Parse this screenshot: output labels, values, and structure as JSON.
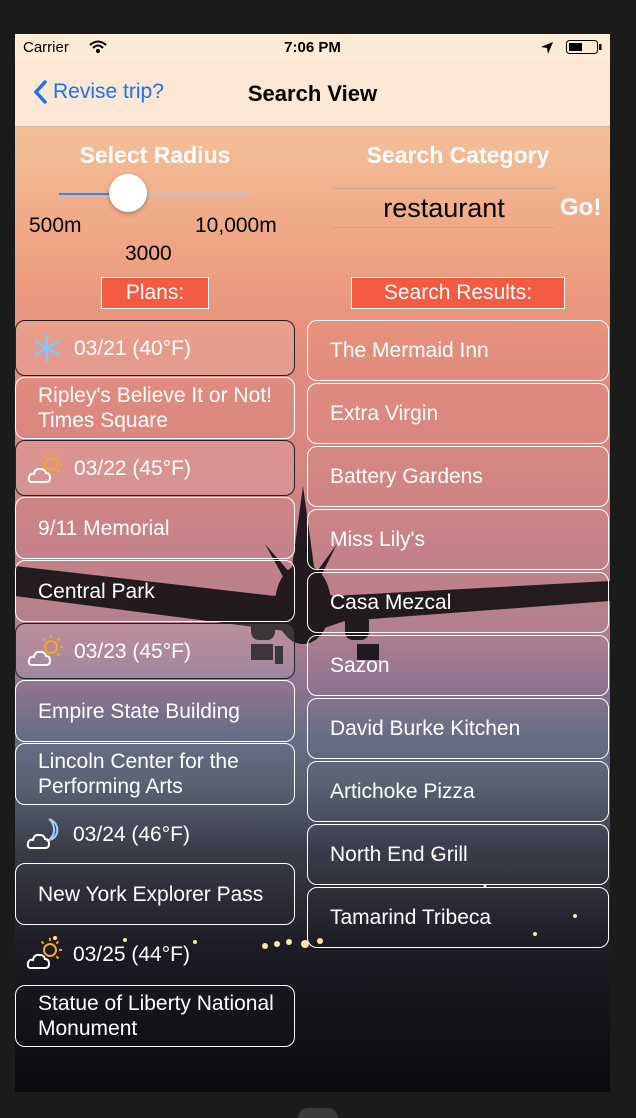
{
  "status": {
    "carrier": "Carrier",
    "time": "7:06 PM"
  },
  "nav": {
    "back_label": "Revise trip?",
    "title": "Search View"
  },
  "radius": {
    "heading": "Select Radius",
    "min_label": "500m",
    "max_label": "10,000m",
    "value_label": "3000"
  },
  "category": {
    "heading": "Search Category",
    "value": "restaurant",
    "go_label": "Go!"
  },
  "plans_label": "Plans:",
  "results_label": "Search Results:",
  "plans": [
    {
      "kind": "day",
      "icon": "snowflake-icon",
      "text": "03/21 (40°F)"
    },
    {
      "kind": "place",
      "text": "Ripley's Believe It or Not! Times Square"
    },
    {
      "kind": "day",
      "icon": "sun-cloud-icon",
      "text": "03/22 (45°F)"
    },
    {
      "kind": "place",
      "text": "9/11 Memorial"
    },
    {
      "kind": "place",
      "text": "Central Park"
    },
    {
      "kind": "day",
      "icon": "sun-cloud-icon",
      "text": "03/23 (45°F)"
    },
    {
      "kind": "place",
      "text": "Empire State Building"
    },
    {
      "kind": "place",
      "text": "Lincoln Center for the Performing Arts"
    },
    {
      "kind": "day",
      "icon": "moon-cloud-icon",
      "text": "03/24 (46°F)"
    },
    {
      "kind": "place",
      "text": "New York Explorer Pass"
    },
    {
      "kind": "day",
      "icon": "sun-cloud-icon",
      "text": "03/25 (44°F)"
    },
    {
      "kind": "place",
      "text": "Statue of Liberty National Monument"
    }
  ],
  "results": [
    "The Mermaid Inn",
    "Extra Virgin",
    "Battery Gardens",
    "Miss Lily's",
    "Casa Mezcal",
    "Sazon",
    "David Burke Kitchen",
    "Artichoke Pizza",
    "North End Grill",
    "Tamarind Tribeca"
  ],
  "colors": {
    "accent": "#2f83ff",
    "tag": "#f35b43",
    "nav_bg": "#fbe7d3"
  }
}
